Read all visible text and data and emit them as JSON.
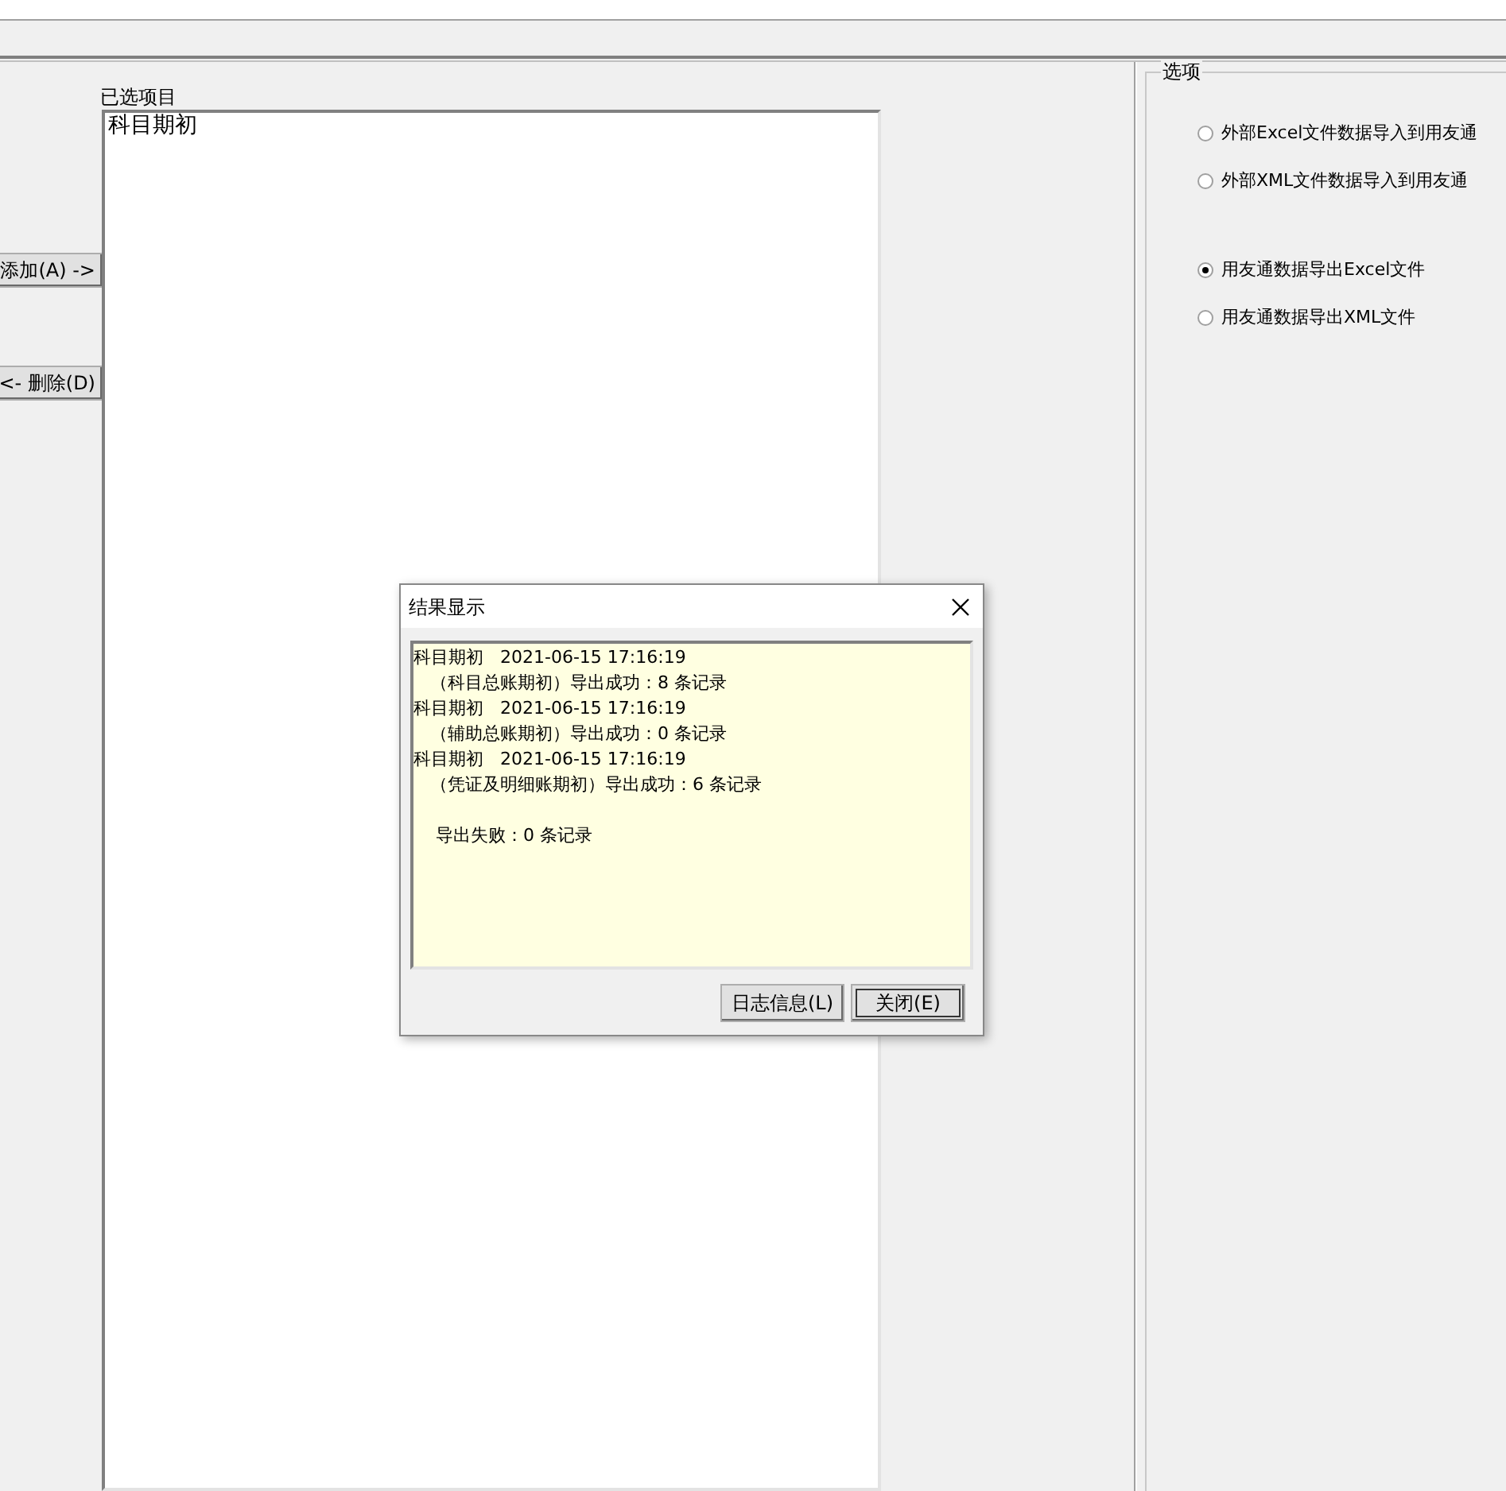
{
  "selected_items": {
    "label": "已选项目",
    "items": [
      "科目期初"
    ]
  },
  "buttons": {
    "add": "添加(A) ->",
    "remove": "<- 删除(D)"
  },
  "options": {
    "title": "选项",
    "radios": [
      {
        "label": "外部Excel文件数据导入到用友通",
        "selected": false
      },
      {
        "label": "外部XML文件数据导入到用友通",
        "selected": false
      },
      {
        "label": "用友通数据导出Excel文件",
        "selected": true
      },
      {
        "label": "用友通数据导出XML文件",
        "selected": false
      }
    ]
  },
  "dialog": {
    "title": "结果显示",
    "log": [
      "科目期初   2021-06-15 17:16:19",
      "   （科目总账期初）导出成功：8 条记录",
      "科目期初   2021-06-15 17:16:19",
      "   （辅助总账期初）导出成功：0 条记录",
      "科目期初   2021-06-15 17:16:19",
      "   （凭证及明细账期初）导出成功：6 条记录"
    ],
    "summary": "    导出失败：0 条记录",
    "buttons": [
      {
        "label": "日志信息(L)",
        "default": false
      },
      {
        "label": "关闭(E)",
        "default": true
      }
    ]
  }
}
